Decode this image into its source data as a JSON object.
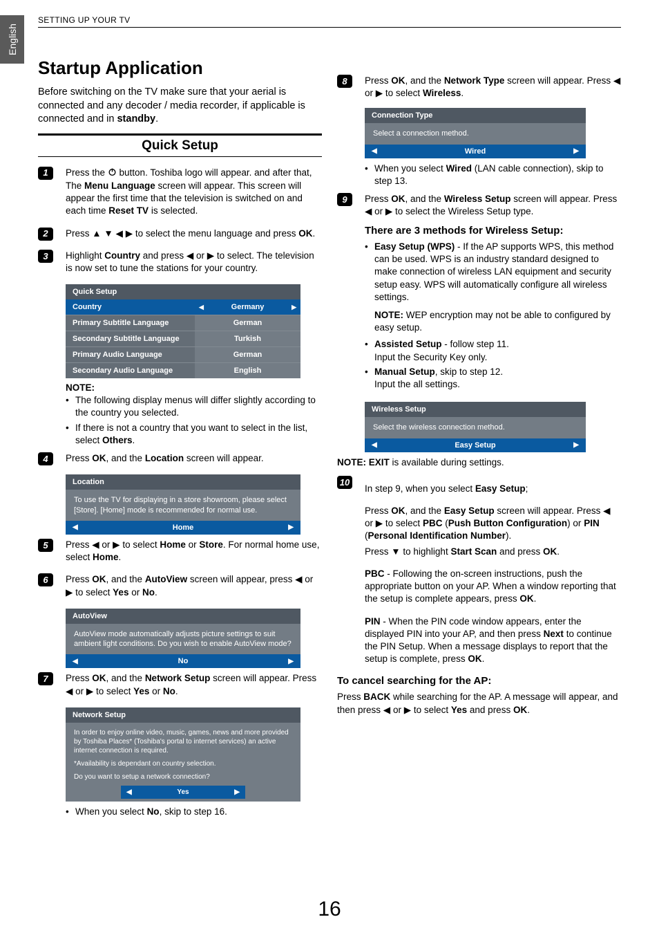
{
  "side_tab": "English",
  "header": "SETTING UP YOUR TV",
  "page_number": "16",
  "left": {
    "title": "Startup Application",
    "intro_parts": [
      "Before switching on the TV make sure that your aerial is connected and any decoder / media recorder, if applicable is connected and in ",
      "standby",
      "."
    ],
    "section": "Quick Setup",
    "steps": {
      "s1": {
        "n": "1",
        "a": "Press the ",
        "b": " button. Toshiba logo will appear. and after that, The ",
        "c": "Menu Language",
        "d": " screen will appear. This screen will appear the first time that the television is switched on and each time ",
        "e": "Reset TV",
        "f": " is selected."
      },
      "s2": {
        "n": "2",
        "a": "Press ",
        "b": " to select the menu language and press ",
        "c": "OK",
        "d": "."
      },
      "s3": {
        "n": "3",
        "a": "Highlight ",
        "b": "Country",
        "c": " and press ",
        "d": " or ",
        "e": " to select. The television is now set to tune the stations for your country."
      },
      "s4": {
        "n": "4",
        "a": "Press ",
        "b": "OK",
        "c": ", and the ",
        "d": "Location",
        "e": " screen will appear."
      },
      "s5": {
        "n": "5",
        "a": "Press ",
        "b": " or ",
        "c": " to select ",
        "d": "Home",
        "e": " or ",
        "f": "Store",
        "g": ". For normal home use, select ",
        "h": "Home",
        "i": "."
      },
      "s6": {
        "n": "6",
        "a": "Press ",
        "b": "OK",
        "c": ", and the ",
        "d": "AutoView",
        "e": " screen will appear, press ",
        "f": " or ",
        "g": " to select ",
        "h": "Yes",
        "i": " or ",
        "j": "No",
        "k": "."
      },
      "s7": {
        "n": "7",
        "a": "Press ",
        "b": "OK",
        "c": ", and the ",
        "d": "Network Setup",
        "e": " screen will appear. Press ",
        "f": " or ",
        "g": " to select ",
        "h": "Yes",
        "i": " or ",
        "j": "No",
        "k": "."
      }
    },
    "quick_setup_table": {
      "title": "Quick Setup",
      "rows": [
        {
          "label": "Country",
          "value": "Germany",
          "hl": true,
          "arrows": true
        },
        {
          "label": "Primary Subtitle Language",
          "value": "German"
        },
        {
          "label": "Secondary Subtitle Language",
          "value": "Turkish"
        },
        {
          "label": "Primary Audio Language",
          "value": "German"
        },
        {
          "label": "Secondary Audio Language",
          "value": "English"
        }
      ]
    },
    "note_after_table": {
      "title": "NOTE:",
      "items": [
        "The following display menus will differ slightly according to the country you selected.",
        {
          "a": "If there is not a country that you want to select in the list, select ",
          "b": "Others",
          "c": "."
        }
      ]
    },
    "location_box": {
      "title": "Location",
      "body": "To use the TV for displaying in a store showroom, please select [Store].  [Home] mode is recommended for normal use.",
      "value": "Home"
    },
    "autoview_box": {
      "title": "AutoView",
      "body": "AutoView mode automatically adjusts picture settings to suit ambient light conditions. Do you wish to enable AutoView mode?",
      "value": "No"
    },
    "network_box": {
      "title": "Network Setup",
      "body1": "In order to enjoy online video, music, games, news and more provided by Toshiba Places* (Toshiba's portal to internet services) an active internet connection is required.",
      "body2": "*Availability is dependant on country selection.",
      "body3": "Do you want to setup a network connection?",
      "value": "Yes"
    },
    "after_network": {
      "a": "When you select ",
      "b": "No",
      "c": ", skip to step 16."
    }
  },
  "right": {
    "s8": {
      "n": "8",
      "a": "Press ",
      "b": "OK",
      "c": ", and the ",
      "d": "Network Type",
      "e": " screen will appear. Press ",
      "f": " or ",
      "g": " to select ",
      "h": "Wireless",
      "i": "."
    },
    "conn_box": {
      "title": "Connection Type",
      "body": "Select a connection method.",
      "value": "Wired"
    },
    "after_conn": {
      "a": "When you select ",
      "b": "Wired",
      "c": " (LAN cable connection), skip to step 13."
    },
    "s9": {
      "n": "9",
      "a": "Press ",
      "b": "OK",
      "c": ", and the ",
      "d": "Wireless Setup",
      "e": " screen will appear. Press ",
      "f": " or ",
      "g": " to select the Wireless Setup type."
    },
    "methods_heading": "There are 3 methods for Wireless Setup:",
    "method1": {
      "a": "Easy Setup (WPS)",
      "b": " - If the AP supports WPS, this method can be used. WPS is an industry standard designed to make connection of wireless LAN equipment and security setup easy. WPS will automatically configure all wireless settings."
    },
    "method1_note": {
      "a": "NOTE:",
      "b": "  WEP encryption may not be able to configured by easy setup."
    },
    "method2": {
      "a": "Assisted Setup",
      "b": " -  follow step 11.",
      "c": "Input the Security Key only."
    },
    "method3": {
      "a": "Manual Setup",
      "b": ", skip to step 12.",
      "c": "Input the all settings."
    },
    "wireless_box": {
      "title": "Wireless Setup",
      "body": "Select the wireless connection method.",
      "value": "Easy Setup"
    },
    "note_exit": {
      "a": "NOTE:",
      "b": " EXIT",
      "c": " is available during settings."
    },
    "s10": {
      "n": "10",
      "line1": {
        "a": "In step 9, when you select ",
        "b": "Easy Setup",
        "c": ";"
      },
      "p1": {
        "a": "Press ",
        "b": "OK",
        "c": ", and the ",
        "d": "Easy Setup",
        "e": " screen will appear. Press ",
        "f": " or ",
        "g": " to select ",
        "h": "PBC",
        "i": " (",
        "j": "Push Button Configuration",
        "k": ") or ",
        "l": "PIN",
        "m": " (",
        "n": "Personal Identification Number",
        "o": ")."
      },
      "p2": {
        "a": "Press ",
        "b": " to highlight ",
        "c": "Start Scan",
        "d": " and press ",
        "e": "OK",
        "f": "."
      },
      "p3": {
        "a": "PBC",
        "b": " - Following the on-screen instructions, push the appropriate button on your AP. When a window reporting that the setup is complete appears, press ",
        "c": "OK",
        "d": "."
      },
      "p4": {
        "a": "PIN",
        "b": " - When the PIN code window appears, enter the displayed PIN into your AP, and then press ",
        "c": "Next",
        "d": " to continue the PIN Setup. When a message displays to report that the setup is complete, press ",
        "e": "OK",
        "f": "."
      }
    },
    "cancel_heading": "To cancel searching for the AP:",
    "cancel_para": {
      "a": "Press ",
      "b": "BACK",
      "c": " while searching for the AP. A message will appear, ",
      "d": "and then press ",
      "e": " or ",
      "f": " to select ",
      "g": "Yes",
      "h": " and press ",
      "i": "OK",
      "j": "."
    }
  }
}
